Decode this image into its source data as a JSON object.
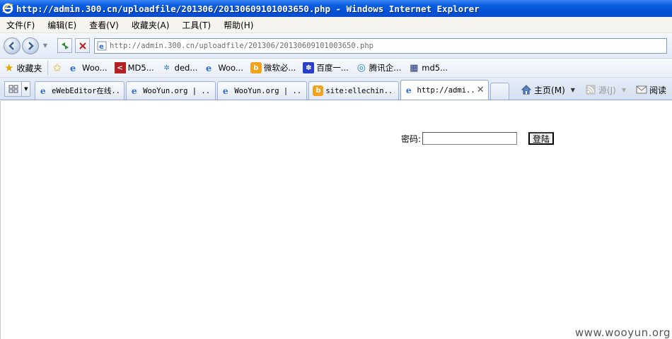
{
  "window": {
    "title": "http://admin.300.cn/uploadfile/201306/20130609101003650.php - Windows Internet Explorer"
  },
  "menu": {
    "items": [
      "文件(F)",
      "编辑(E)",
      "查看(V)",
      "收藏夹(A)",
      "工具(T)",
      "帮助(H)"
    ]
  },
  "address": {
    "url": "http://admin.300.cn/uploadfile/201306/20130609101003650.php"
  },
  "favorites": {
    "root_label": "收藏夹",
    "items": [
      {
        "label": "Woo...",
        "icon": "ie-page-icon"
      },
      {
        "label": "MD5...",
        "icon": "md5-site-icon"
      },
      {
        "label": "ded...",
        "icon": "dedecms-icon"
      },
      {
        "label": "Woo...",
        "icon": "ie-page-icon"
      },
      {
        "label": "微软必...",
        "icon": "bing-icon"
      },
      {
        "label": "百度一...",
        "icon": "baidu-paw-icon"
      },
      {
        "label": "腾讯企...",
        "icon": "tencent-icon"
      },
      {
        "label": "md5...",
        "icon": "grid-site-icon"
      }
    ]
  },
  "tabs": [
    {
      "label": "eWebEditor在线...",
      "icon": "ie-page-icon",
      "active": false
    },
    {
      "label": "WooYun.org | ...",
      "icon": "ie-page-icon",
      "active": false
    },
    {
      "label": "WooYun.org | ...",
      "icon": "ie-page-icon",
      "active": false
    },
    {
      "label": "site:ellechin...",
      "icon": "bing-icon",
      "active": false
    },
    {
      "label": "http://admi...",
      "icon": "ie-page-icon",
      "active": true
    }
  ],
  "commands": {
    "home": "主页(M)",
    "feeds": "源(J)",
    "read_mail": "阅读"
  },
  "page": {
    "password_label": "密码:",
    "password_value": "",
    "login_button": "登陆"
  },
  "watermark": "www.wooyun.org",
  "colors": {
    "titlebar": "#0351d6",
    "menubar": "#f5f4ee",
    "toolbar": "#e2ebf8"
  }
}
